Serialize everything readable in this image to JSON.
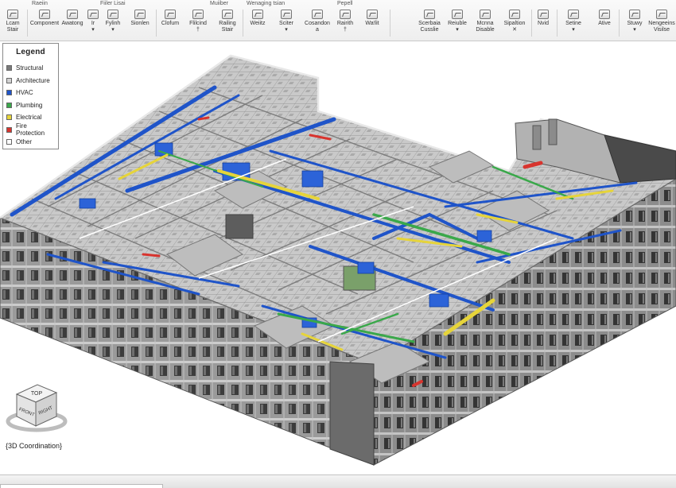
{
  "ribbon": {
    "groups": [
      {
        "label": "Raeiin"
      },
      {
        "label": "Fiiler Lisai"
      },
      {
        "label": "Muiiber"
      },
      {
        "label": "Wenaging tsian"
      },
      {
        "label": "Pepell"
      }
    ],
    "tools": [
      {
        "line1": "Lcam",
        "line2": "Stair"
      },
      {
        "line1": "Component",
        "line2": ""
      },
      {
        "line1": "Awatong",
        "line2": ""
      },
      {
        "line1": "Ir",
        "line2": "▾"
      },
      {
        "line1": "Fylinh",
        "line2": "▾"
      },
      {
        "line1": "Sionlen",
        "line2": ""
      },
      {
        "line1": "Clofum",
        "line2": ""
      },
      {
        "line1": "Flilcind",
        "line2": "†"
      },
      {
        "line1": "Railing",
        "line2": "Stair"
      },
      {
        "line1": "Weiitz",
        "line2": ""
      },
      {
        "line1": "Sciter",
        "line2": "▾"
      },
      {
        "line1": "Cosandon",
        "line2": "a"
      },
      {
        "line1": "Rairith",
        "line2": "†"
      },
      {
        "line1": "Wa!lit",
        "line2": ""
      },
      {
        "line1": "Scerbaia",
        "line2": "Cusslie"
      },
      {
        "line1": "Reiuble",
        "line2": "▾"
      },
      {
        "line1": "Mcnna",
        "line2": "Disable"
      },
      {
        "line1": "Sipaltion",
        "line2": "✕"
      },
      {
        "line1": "Nvid",
        "line2": ""
      },
      {
        "line1": "Setine",
        "line2": "▾"
      },
      {
        "line1": "Ative",
        "line2": ""
      },
      {
        "line1": "Stuwy",
        "line2": "▾"
      },
      {
        "line1": "Nengeeins",
        "line2": "Visilse"
      }
    ]
  },
  "legend": {
    "title": "Legend",
    "items": [
      {
        "label": "Structural",
        "color": "#7a7a7a"
      },
      {
        "label": "Architecture",
        "color": "#d2d2d2"
      },
      {
        "label": "HVAC",
        "color": "#1f54c9"
      },
      {
        "label": "Plumbing",
        "color": "#3aa84a"
      },
      {
        "label": "Electrical",
        "color": "#e6d43a"
      },
      {
        "label": "Fire Protection",
        "color": "#d8342e"
      },
      {
        "label": "Other",
        "color": "#ffffff"
      }
    ]
  },
  "viewcube": {
    "top": "TOP",
    "front": "FRONT",
    "right": "RIGHT"
  },
  "caption": "{3D Coordination}"
}
